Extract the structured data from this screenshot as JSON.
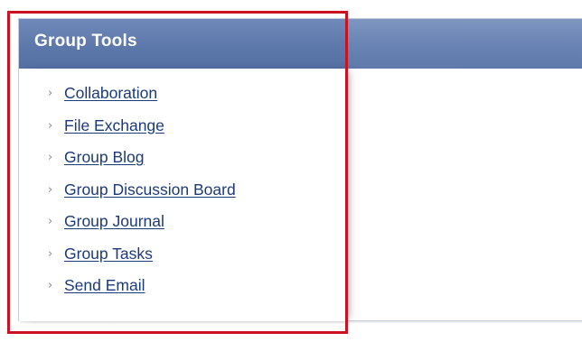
{
  "panel": {
    "title": "Group Tools",
    "items": [
      {
        "label": "Collaboration"
      },
      {
        "label": "File Exchange"
      },
      {
        "label": "Group Blog"
      },
      {
        "label": "Group Discussion Board"
      },
      {
        "label": "Group Journal"
      },
      {
        "label": "Group Tasks"
      },
      {
        "label": "Send Email"
      }
    ]
  },
  "colors": {
    "header": "#5d78aa",
    "link": "#1b3a7a",
    "highlight": "#cc1122"
  },
  "icons": {
    "item_bullet": "chevron-right-icon"
  }
}
